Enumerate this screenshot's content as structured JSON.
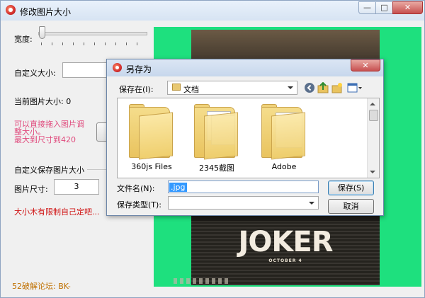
{
  "app": {
    "title": "修改图片大小",
    "window_buttons": {
      "minimize": "—",
      "maximize": "□",
      "close": "✕"
    }
  },
  "left_panel": {
    "width_label": "宽度:",
    "custom_size_label": "自定义大小:",
    "custom_size_value": "",
    "current_size_label": "当前图片大小: 0",
    "hint_line1": "可以直接拖入图片调",
    "hint_line2": "整大小。",
    "hint_line3": "最大到尺寸到420",
    "custom_save_group": "自定义保存图片大小",
    "image_size_label": "图片尺寸:",
    "image_size_value": "3",
    "limit_note": "大小木有限制自己定吧...",
    "footer": "52破解论坛:  BK-"
  },
  "poster": {
    "title": "JOKER",
    "date": "OCTOBER 4"
  },
  "dialog": {
    "title": "另存为",
    "close": "✕",
    "save_in_label": "保存在(I):",
    "save_in_value": "文档",
    "items": [
      {
        "name": "360js Files"
      },
      {
        "name": "2345截图"
      },
      {
        "name": "Adobe"
      }
    ],
    "filename_label": "文件名(N):",
    "filename_value": ".jpg",
    "filetype_label": "保存类型(T):",
    "filetype_value": "",
    "save_button": "保存(S)",
    "cancel_button": "取消"
  },
  "colors": {
    "preview_bg": "#1ee07e",
    "hint_pink": "#e0497c",
    "note_red": "#d01515",
    "footer_orange": "#c07000"
  },
  "icons": [
    "back-icon",
    "up-folder-icon",
    "new-folder-icon",
    "view-menu-icon"
  ]
}
